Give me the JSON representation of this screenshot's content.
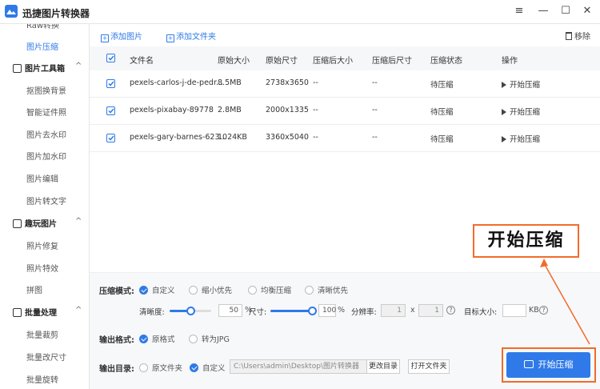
{
  "app": {
    "title": "迅捷图片转换器"
  },
  "window": {
    "menu_icon": "≡",
    "min_icon": "—",
    "max_icon": "☐",
    "close_icon": "✕"
  },
  "sidebar": {
    "items": [
      {
        "label": "Raw转换"
      },
      {
        "label": "图片压缩"
      },
      {
        "label": "图片工具箱",
        "section": true
      },
      {
        "label": "抠图换背景"
      },
      {
        "label": "智能证件照"
      },
      {
        "label": "图片去水印"
      },
      {
        "label": "图片加水印"
      },
      {
        "label": "图片编辑"
      },
      {
        "label": "图片转文字"
      },
      {
        "label": "趣玩图片",
        "section": true
      },
      {
        "label": "照片修复"
      },
      {
        "label": "照片特效"
      },
      {
        "label": "拼图"
      },
      {
        "label": "批量处理",
        "section": true
      },
      {
        "label": "批量裁剪"
      },
      {
        "label": "批量改尺寸"
      },
      {
        "label": "批量旋转"
      }
    ]
  },
  "toolbar": {
    "add_image": "添加图片",
    "add_folder": "添加文件夹",
    "remove": "移除"
  },
  "table": {
    "headers": [
      "文件名",
      "原始大小",
      "原始尺寸",
      "压缩后大小",
      "压缩后尺寸",
      "压缩状态",
      "操作"
    ],
    "rows": [
      {
        "name": "pexels-carlos-j-de-pedr...",
        "size": "8.5MB",
        "dims": "2738x3650",
        "after_size": "--",
        "after_dims": "--",
        "status": "待压缩",
        "action": "开始压缩"
      },
      {
        "name": "pexels-pixabay-89778",
        "size": "2.8MB",
        "dims": "2000x1335",
        "after_size": "--",
        "after_dims": "--",
        "status": "待压缩",
        "action": "开始压缩"
      },
      {
        "name": "pexels-gary-barnes-623...",
        "size": "1024KB",
        "dims": "3360x5040",
        "after_size": "--",
        "after_dims": "--",
        "status": "待压缩",
        "action": "开始压缩"
      }
    ]
  },
  "settings": {
    "mode_label": "压缩模式:",
    "modes": [
      "自定义",
      "缩小优先",
      "均衡压缩",
      "清晰优先"
    ],
    "clarity_label": "清晰度:",
    "clarity_value": "50",
    "clarity_fraction": 0.5,
    "percent": "%",
    "size_label": "尺寸:",
    "size_value": "100",
    "size_fraction": 1.0,
    "resolution_label": "分辨率:",
    "res_w": "1",
    "res_x": "x",
    "res_h": "1",
    "target_label": "目标大小:",
    "target_unit": "KB",
    "format_label": "输出格式:",
    "formats": [
      "原格式",
      "转为JPG"
    ],
    "dir_label": "输出目录:",
    "dirs": [
      "原文件夹",
      "自定义"
    ],
    "path": "C:\\Users\\admin\\Desktop\\图片转换器",
    "change_dir": "更改目录",
    "open_folder": "打开文件夹"
  },
  "start_button": "开始压缩",
  "callout": "开始压缩",
  "colors": {
    "accent": "#2f7ae8",
    "highlight": "#f26b2b"
  }
}
